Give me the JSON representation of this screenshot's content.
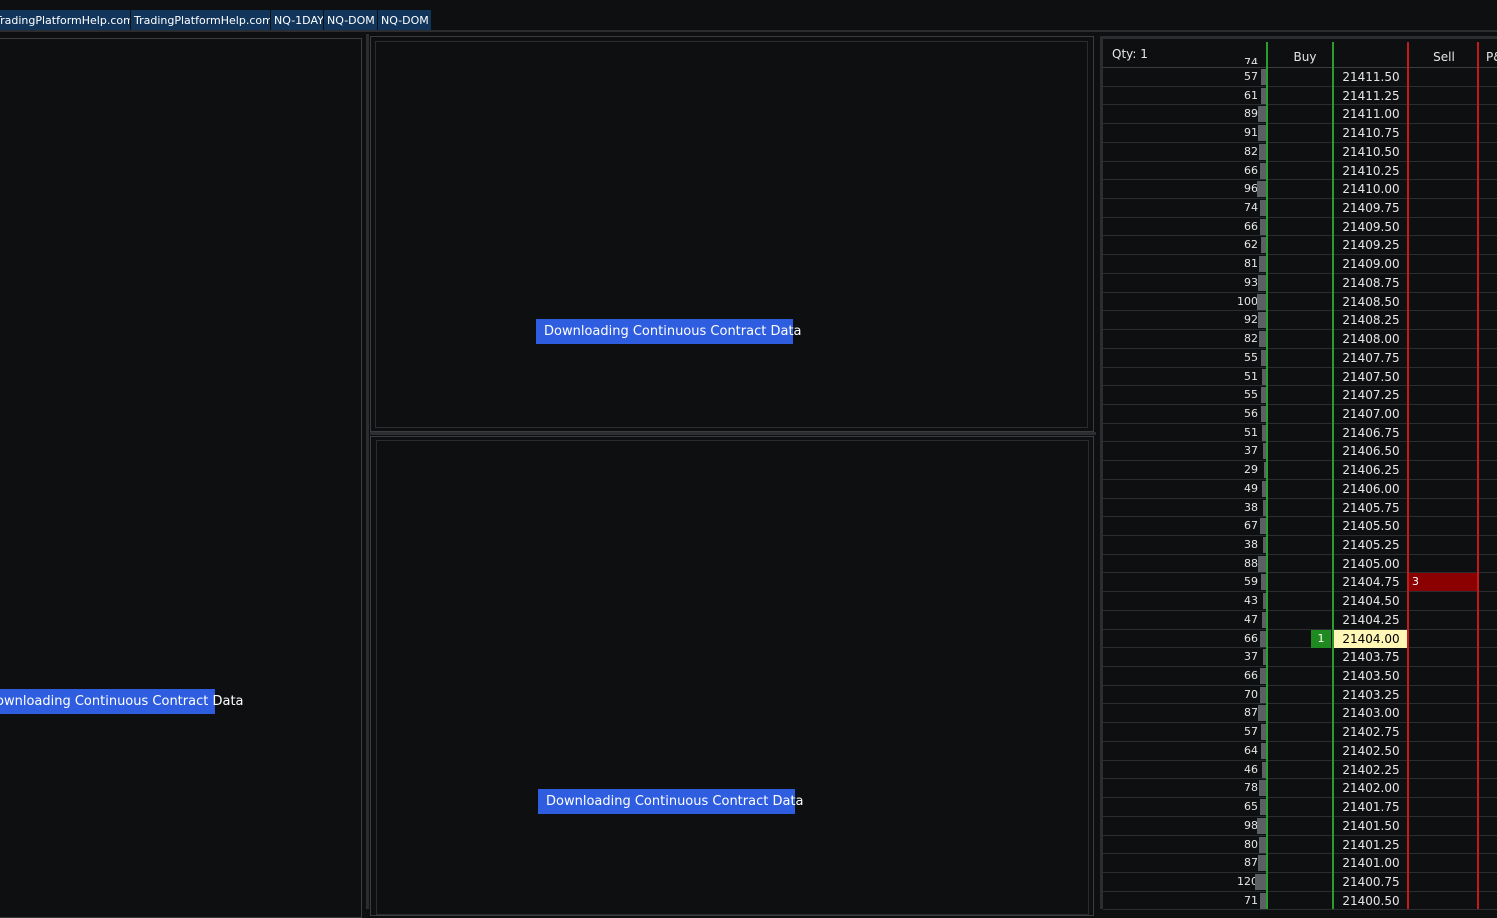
{
  "tabs": [
    "TradingPlatformHelp.com",
    "TradingPlatformHelp.com",
    "NQ-1DAY",
    "NQ-DOM",
    "NQ-DOM"
  ],
  "panels": {
    "left_message": "Downloading Continuous Contract Data",
    "top_right_message": "Downloading Continuous Contract Data",
    "bottom_right_message": "Downloading Continuous Contract Data"
  },
  "dom": {
    "qty_label": "Qty: 1",
    "columns": {
      "buy": "Buy",
      "sell": "Sell",
      "pnl": "P&"
    },
    "top_partial_volume": "74",
    "rows": [
      {
        "vol": "57",
        "price": "21411.50"
      },
      {
        "vol": "61",
        "price": "21411.25"
      },
      {
        "vol": "89",
        "price": "21411.00"
      },
      {
        "vol": "91",
        "price": "21410.75"
      },
      {
        "vol": "82",
        "price": "21410.50"
      },
      {
        "vol": "66",
        "price": "21410.25"
      },
      {
        "vol": "96",
        "price": "21410.00"
      },
      {
        "vol": "74",
        "price": "21409.75"
      },
      {
        "vol": "66",
        "price": "21409.50"
      },
      {
        "vol": "62",
        "price": "21409.25"
      },
      {
        "vol": "81",
        "price": "21409.00"
      },
      {
        "vol": "93",
        "price": "21408.75"
      },
      {
        "vol": "100",
        "price": "21408.50"
      },
      {
        "vol": "92",
        "price": "21408.25"
      },
      {
        "vol": "82",
        "price": "21408.00"
      },
      {
        "vol": "55",
        "price": "21407.75"
      },
      {
        "vol": "51",
        "price": "21407.50"
      },
      {
        "vol": "55",
        "price": "21407.25"
      },
      {
        "vol": "56",
        "price": "21407.00"
      },
      {
        "vol": "51",
        "price": "21406.75"
      },
      {
        "vol": "37",
        "price": "21406.50"
      },
      {
        "vol": "29",
        "price": "21406.25"
      },
      {
        "vol": "49",
        "price": "21406.00"
      },
      {
        "vol": "38",
        "price": "21405.75"
      },
      {
        "vol": "67",
        "price": "21405.50"
      },
      {
        "vol": "38",
        "price": "21405.25"
      },
      {
        "vol": "88",
        "price": "21405.00"
      },
      {
        "vol": "59",
        "price": "21404.75",
        "sell": "3"
      },
      {
        "vol": "43",
        "price": "21404.50"
      },
      {
        "vol": "47",
        "price": "21404.25"
      },
      {
        "vol": "66",
        "price": "21404.00",
        "buy": "1",
        "current": true
      },
      {
        "vol": "37",
        "price": "21403.75"
      },
      {
        "vol": "66",
        "price": "21403.50"
      },
      {
        "vol": "70",
        "price": "21403.25"
      },
      {
        "vol": "87",
        "price": "21403.00"
      },
      {
        "vol": "57",
        "price": "21402.75"
      },
      {
        "vol": "64",
        "price": "21402.50"
      },
      {
        "vol": "46",
        "price": "21402.25"
      },
      {
        "vol": "78",
        "price": "21402.00"
      },
      {
        "vol": "65",
        "price": "21401.75"
      },
      {
        "vol": "98",
        "price": "21401.50"
      },
      {
        "vol": "80",
        "price": "21401.25"
      },
      {
        "vol": "87",
        "price": "21401.00"
      },
      {
        "vol": "120",
        "price": "21400.75"
      },
      {
        "vol": "71",
        "price": "21400.50"
      }
    ]
  },
  "colors": {
    "tab_bg": "#12355c",
    "label_bg": "#2e5de0",
    "buy_line": "#2a9d2a",
    "sell_line": "#c41a1a",
    "sell_order": "#8b0000",
    "buy_order": "#1f8a1f",
    "current_price": "#fff7b5"
  }
}
